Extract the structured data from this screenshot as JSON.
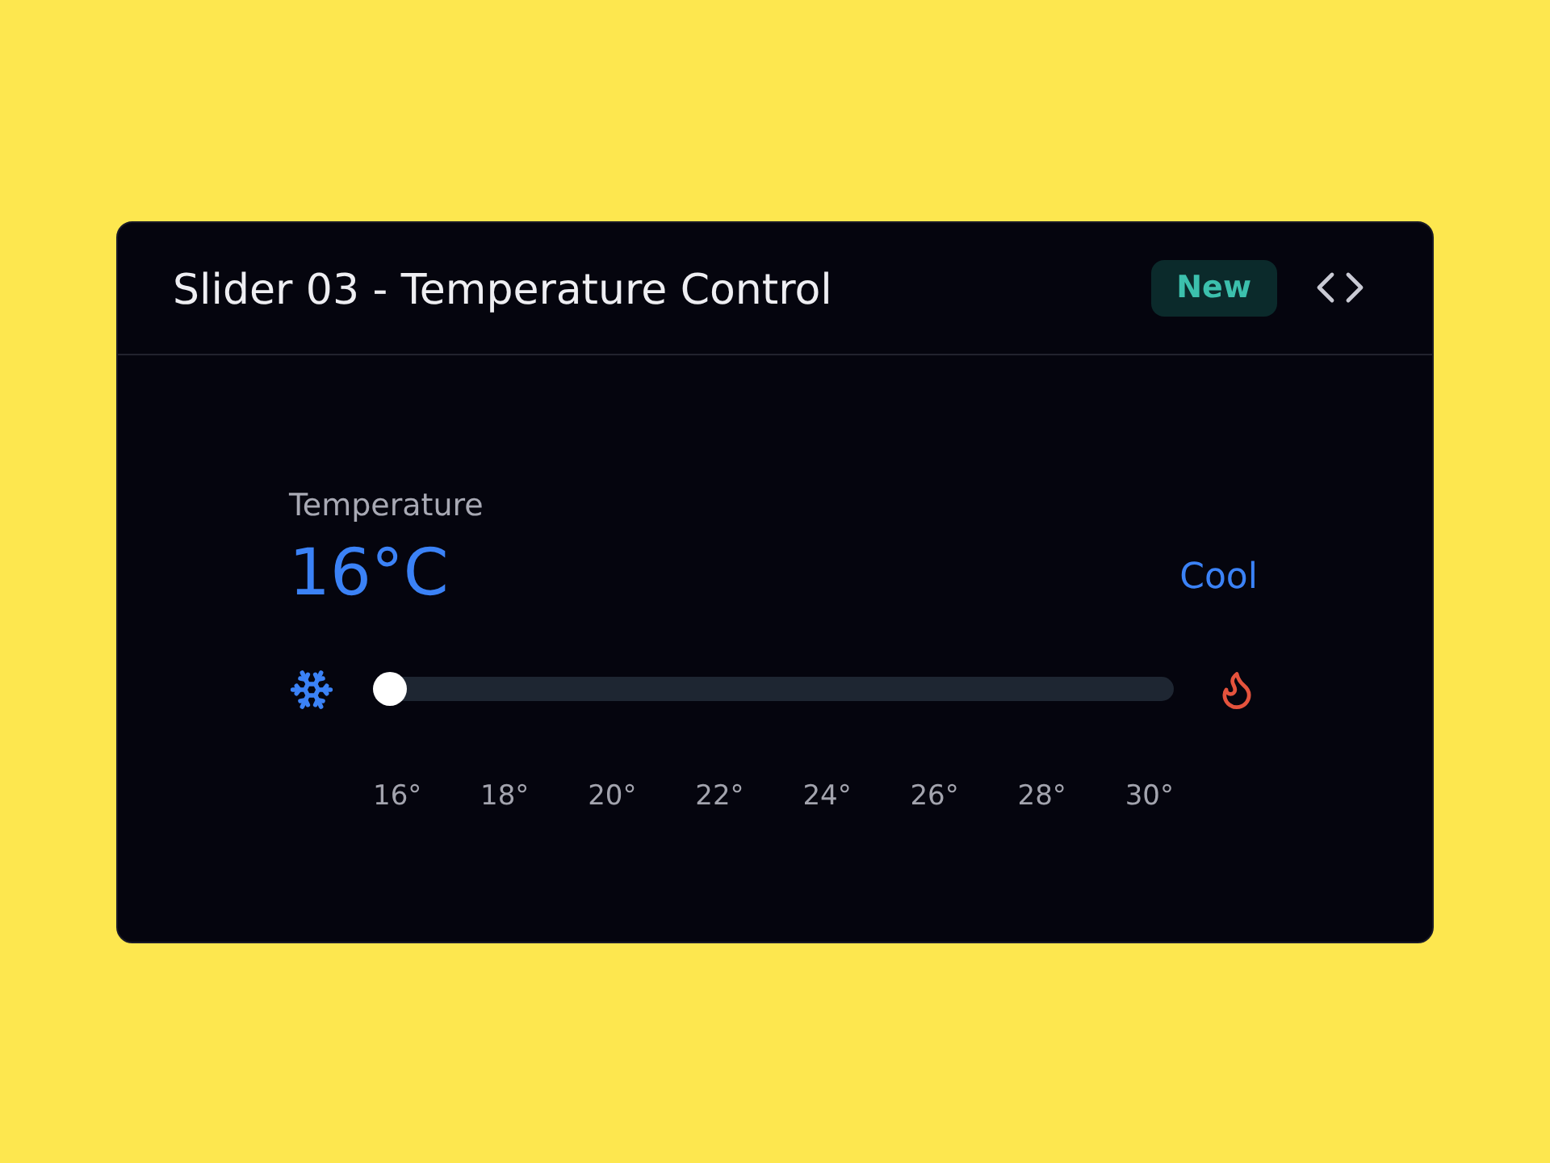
{
  "card": {
    "title": "Slider 03 - Temperature Control",
    "badge": "New"
  },
  "slider": {
    "label": "Temperature",
    "value": "16°C",
    "mode": "Cool",
    "level": 0,
    "ticks": [
      "16°",
      "18°",
      "20°",
      "22°",
      "24°",
      "26°",
      "28°",
      "30°"
    ]
  }
}
